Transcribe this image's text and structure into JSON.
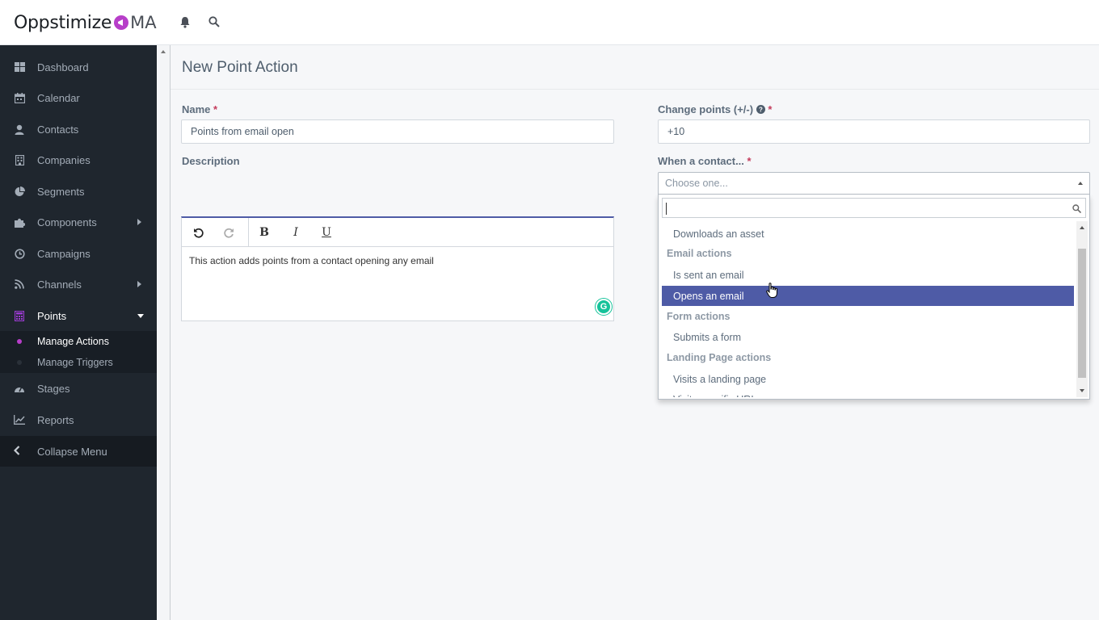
{
  "app": {
    "logo_text": "Oppstimize",
    "logo_suffix": "MA"
  },
  "topbar": {
    "icons": [
      "bell-icon",
      "search-icon"
    ]
  },
  "sidebar": {
    "items": [
      {
        "label": "Dashboard",
        "icon": "dashboard-icon"
      },
      {
        "label": "Calendar",
        "icon": "calendar-icon"
      },
      {
        "label": "Contacts",
        "icon": "user-icon"
      },
      {
        "label": "Companies",
        "icon": "building-icon"
      },
      {
        "label": "Segments",
        "icon": "pie-chart-icon"
      },
      {
        "label": "Components",
        "icon": "puzzle-icon"
      },
      {
        "label": "Campaigns",
        "icon": "clock-icon"
      },
      {
        "label": "Channels",
        "icon": "rss-icon"
      },
      {
        "label": "Points",
        "icon": "calculator-icon"
      },
      {
        "label": "Stages",
        "icon": "tachometer-icon"
      },
      {
        "label": "Reports",
        "icon": "line-chart-icon"
      }
    ],
    "submenu": [
      {
        "label": "Manage Actions"
      },
      {
        "label": "Manage Triggers"
      }
    ],
    "collapse_label": "Collapse Menu"
  },
  "page": {
    "title": "New Point Action"
  },
  "form": {
    "name_label": "Name",
    "name_value": "Points from email open",
    "description_label": "Description",
    "description_text": "This action adds points from a contact opening any email",
    "points_label": "Change points (+/-)",
    "points_value": "+10",
    "when_label": "When a contact...",
    "when_placeholder": "Choose one...",
    "required_mark": "*"
  },
  "dropdown": {
    "options": [
      {
        "type": "option",
        "label": "Downloads an asset"
      },
      {
        "type": "group",
        "label": "Email actions"
      },
      {
        "type": "option",
        "label": "Is sent an email"
      },
      {
        "type": "option",
        "label": "Opens an email",
        "selected": true
      },
      {
        "type": "group",
        "label": "Form actions"
      },
      {
        "type": "option",
        "label": "Submits a form"
      },
      {
        "type": "group",
        "label": "Landing Page actions"
      },
      {
        "type": "option",
        "label": "Visits a landing page"
      },
      {
        "type": "option",
        "label": "Visits specific URL"
      }
    ]
  },
  "colors": {
    "accent": "#4e5ba6",
    "brand": "#b73ec9",
    "sidebar_bg": "#1f262e"
  }
}
